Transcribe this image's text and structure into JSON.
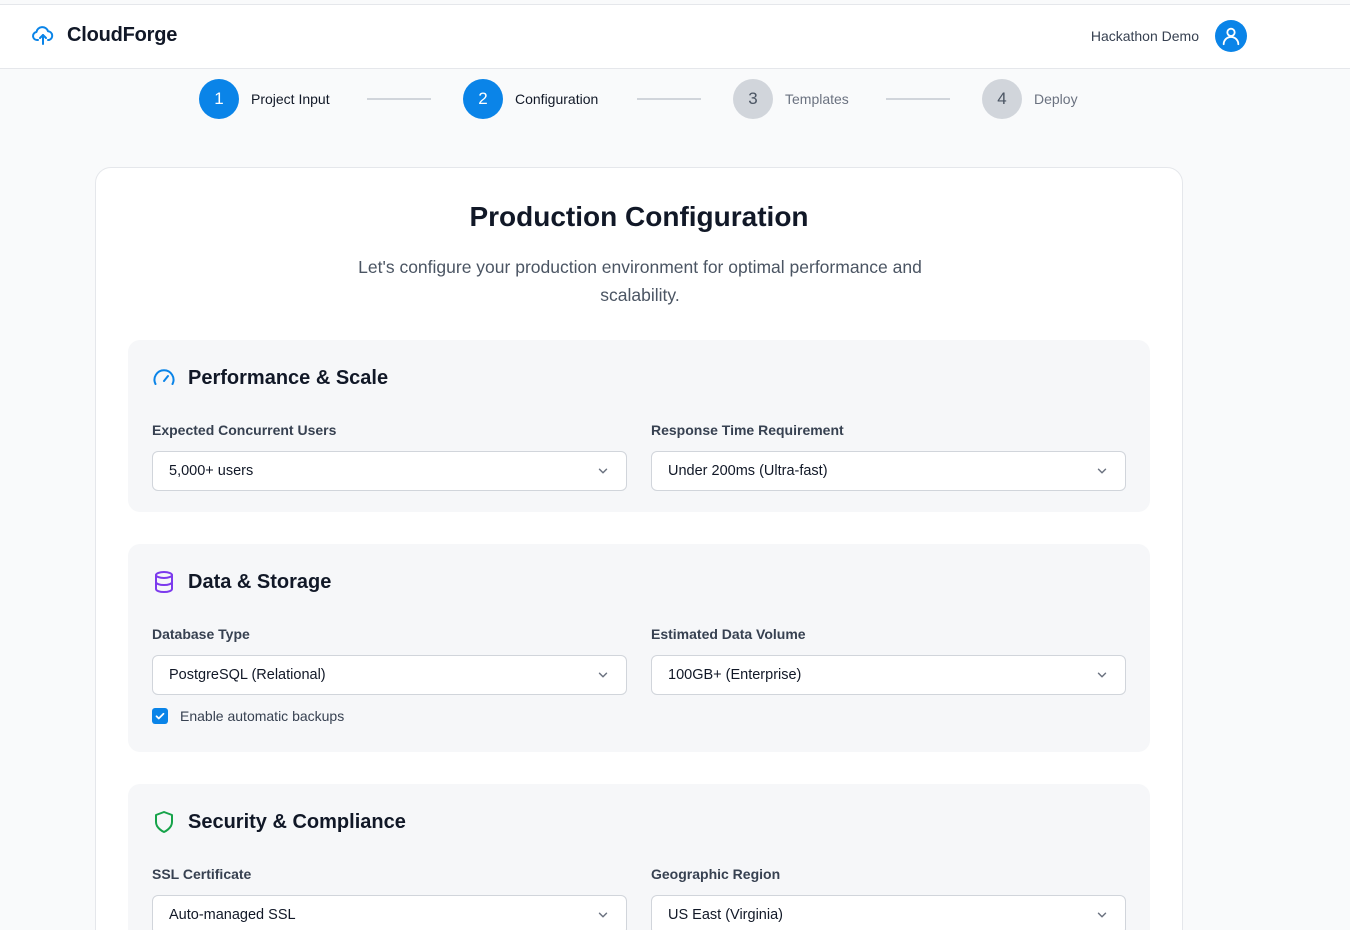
{
  "header": {
    "brand_name": "CloudForge",
    "brand_icon": "cloud-upload-icon",
    "user_name": "Hackathon Demo",
    "avatar_icon": "user-icon",
    "accent_color": "#0a84e8"
  },
  "stepper": {
    "steps": [
      {
        "number": "1",
        "label": "Project Input",
        "state": "active"
      },
      {
        "number": "2",
        "label": "Configuration",
        "state": "active"
      },
      {
        "number": "3",
        "label": "Templates",
        "state": "inactive"
      },
      {
        "number": "4",
        "label": "Deploy",
        "state": "inactive"
      }
    ]
  },
  "main": {
    "title": "Production Configuration",
    "subtitle": "Let's configure your production environment for optimal performance and scalability."
  },
  "sections": {
    "performance": {
      "title": "Performance & Scale",
      "icon": "speedometer-icon",
      "icon_color": "#0a84e8",
      "fields": [
        {
          "label": "Expected Concurrent Users",
          "value": "5,000+ users"
        },
        {
          "label": "Response Time Requirement",
          "value": "Under 200ms (Ultra-fast)"
        }
      ]
    },
    "data": {
      "title": "Data & Storage",
      "icon": "database-icon",
      "icon_color": "#7c3aed",
      "fields": [
        {
          "label": "Database Type",
          "value": "PostgreSQL (Relational)"
        },
        {
          "label": "Estimated Data Volume",
          "value": "100GB+ (Enterprise)"
        }
      ],
      "checkbox": {
        "label": "Enable automatic backups",
        "checked": true
      }
    },
    "security": {
      "title": "Security & Compliance",
      "icon": "shield-icon",
      "icon_color": "#16a34a",
      "fields": [
        {
          "label": "SSL Certificate",
          "value": "Auto-managed SSL"
        },
        {
          "label": "Geographic Region",
          "value": "US East (Virginia)"
        }
      ]
    }
  }
}
